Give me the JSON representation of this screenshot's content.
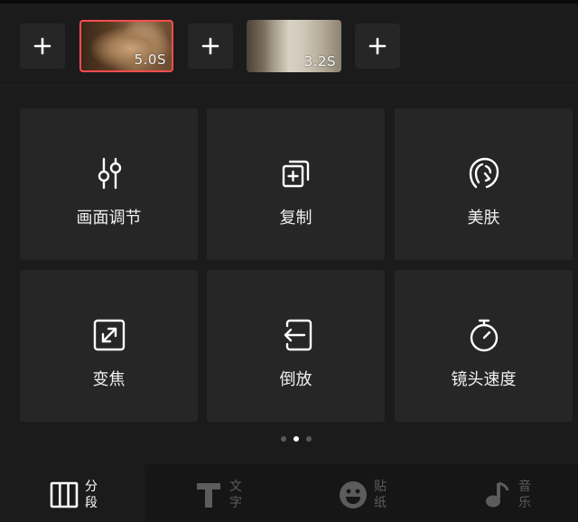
{
  "timeline": {
    "clips": [
      {
        "duration": "5.0S",
        "selected": true
      },
      {
        "duration": "3.2S",
        "selected": false
      }
    ],
    "add_symbol": "+"
  },
  "tools": [
    {
      "label": "画面调节",
      "icon": "sliders-icon"
    },
    {
      "label": "复制",
      "icon": "copy-icon"
    },
    {
      "label": "美肤",
      "icon": "face-beauty-icon"
    },
    {
      "label": "变焦",
      "icon": "zoom-expand-icon"
    },
    {
      "label": "倒放",
      "icon": "reverse-icon"
    },
    {
      "label": "镜头速度",
      "icon": "stopwatch-icon"
    }
  ],
  "pagination": {
    "pages": 3,
    "current": 2
  },
  "bottom_nav": [
    {
      "label": "分段",
      "icon": "segment-icon",
      "active": true
    },
    {
      "label": "文字",
      "icon": "text-icon",
      "active": false
    },
    {
      "label": "贴纸",
      "icon": "sticker-icon",
      "active": false
    },
    {
      "label": "音乐",
      "icon": "music-icon",
      "active": false
    }
  ],
  "colors": {
    "background": "#1b1b1c",
    "tile": "#262627",
    "selected_border": "#ff4d4f",
    "nav_background": "#161617",
    "inactive_text": "#5c5c5e"
  }
}
